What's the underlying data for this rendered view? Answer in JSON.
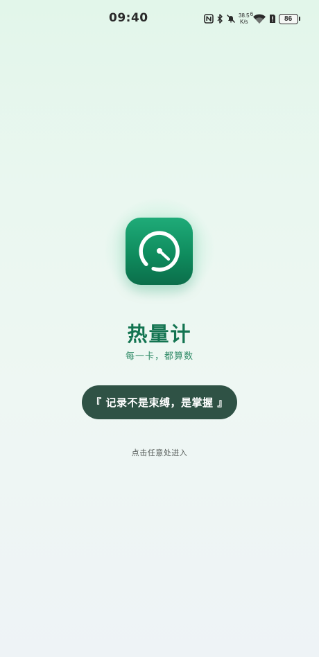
{
  "status_bar": {
    "time": "09:40",
    "net_speed_value": "38.5",
    "net_speed_unit": "K/s",
    "wifi_label": "6",
    "battery": "86",
    "icons": [
      "nfc-icon",
      "bluetooth-icon",
      "mute-icon",
      "wifi-icon",
      "sim-alert-icon",
      "battery-icon"
    ]
  },
  "app": {
    "icon": "timer-dial-icon",
    "title": "热量计",
    "subtitle": "每一卡，都算数",
    "quote": "『 记录不是束缚，是掌握 』",
    "enter_hint": "点击任意处进入"
  },
  "colors": {
    "brand": "#137451",
    "icon_gradient_top": "#1fab78",
    "icon_gradient_bottom": "#0b6e4a",
    "quote_bg": "#2f5245"
  }
}
